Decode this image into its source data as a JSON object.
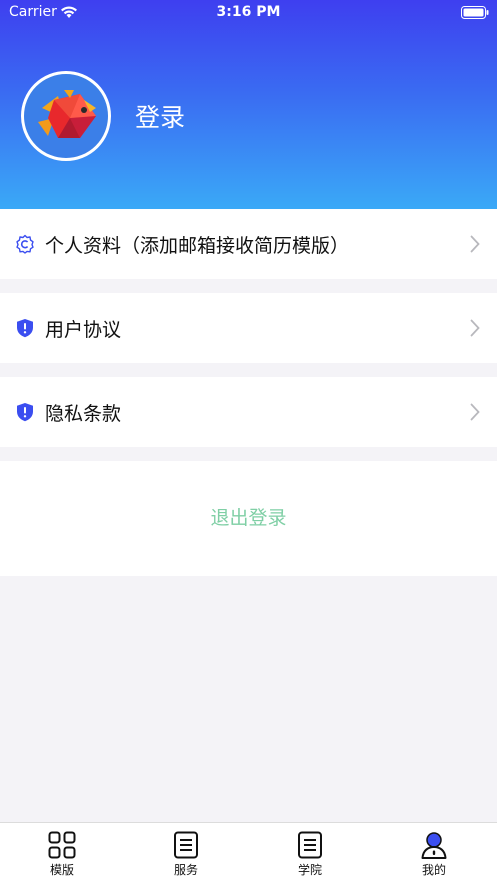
{
  "status_bar": {
    "carrier": "Carrier",
    "time": "3:16 PM"
  },
  "header": {
    "title": "登录"
  },
  "menu": [
    {
      "label": "个人资料（添加邮箱接收简历模版）",
      "icon": "gear-icon"
    },
    {
      "label": "用户协议",
      "icon": "shield-alert-icon"
    },
    {
      "label": "隐私条款",
      "icon": "shield-alert-icon"
    }
  ],
  "logout": {
    "label": "退出登录",
    "color": "#7fcfa5"
  },
  "tabbar": [
    {
      "label": "模版",
      "icon": "grid-icon"
    },
    {
      "label": "服务",
      "icon": "document-icon"
    },
    {
      "label": "学院",
      "icon": "document-icon"
    },
    {
      "label": "我的",
      "icon": "person-icon",
      "active": true
    }
  ],
  "colors": {
    "accent": "#3b4ef0",
    "header_top": "#3e3ff0",
    "header_bottom": "#3aa9f7"
  }
}
